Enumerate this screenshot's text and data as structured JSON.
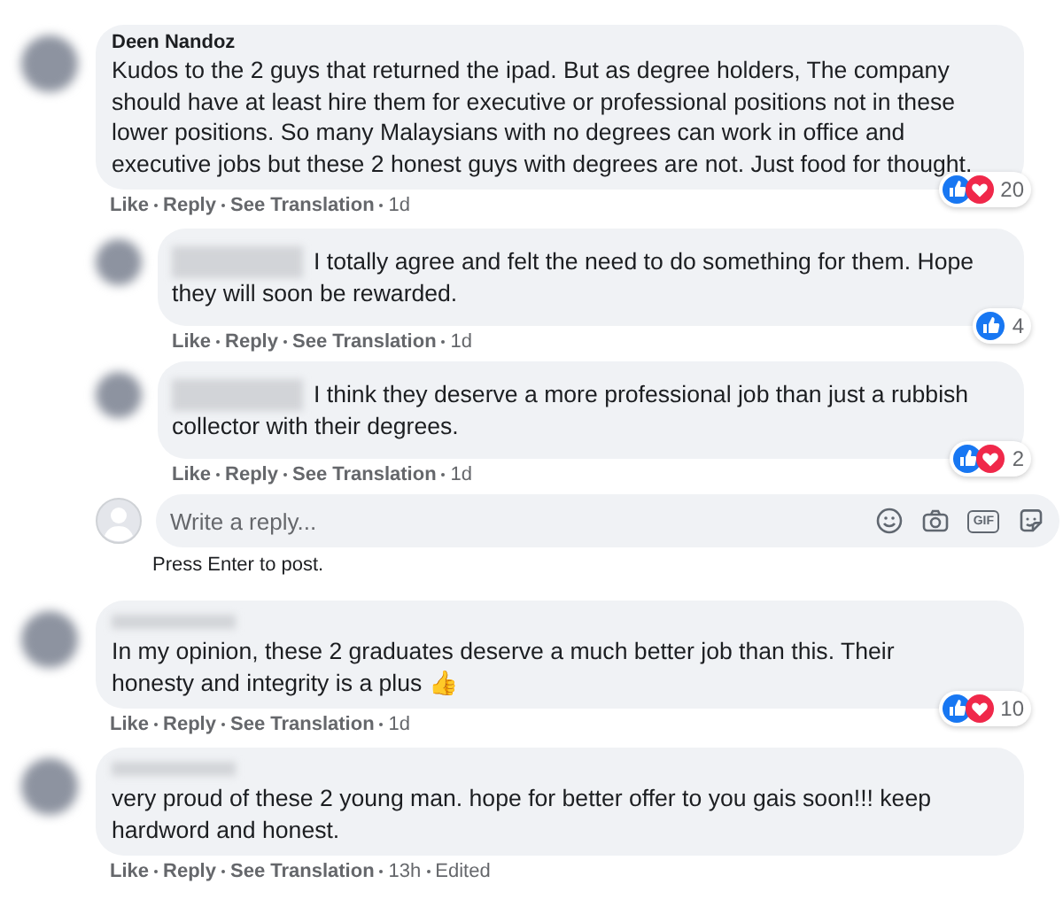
{
  "comments": [
    {
      "author": "Deen Nandoz",
      "text": "Kudos to the 2 guys that returned the ipad. But as degree holders, The company should have at least hire them for executive or professional positions not in these lower positions. So many Malaysians with no degrees can work in office and executive jobs but these 2 honest guys with degrees are not. Just food for thought.",
      "reactions": {
        "like": true,
        "love": true,
        "count": "20"
      },
      "actions": [
        "Like",
        "Reply",
        "See Translation"
      ],
      "time": "1d",
      "replies": [
        {
          "name_blurred": true,
          "text": "I totally agree and felt the need to do something for them. Hope they will soon be rewarded.",
          "reactions": {
            "like": true,
            "love": false,
            "count": "4"
          },
          "actions": [
            "Like",
            "Reply",
            "See Translation"
          ],
          "time": "1d"
        },
        {
          "name_blurred": true,
          "text": "I think they deserve a more professional job than just a rubbish collector with their degrees.",
          "reactions": {
            "like": true,
            "love": true,
            "count": "2"
          },
          "actions": [
            "Like",
            "Reply",
            "See Translation"
          ],
          "time": "1d"
        }
      ],
      "reply_box": {
        "placeholder": "Write a reply...",
        "tools": [
          {
            "kind": "emoji"
          },
          {
            "kind": "camera"
          },
          {
            "kind": "gif",
            "label": "GIF"
          },
          {
            "kind": "sticker"
          }
        ],
        "hint": "Press Enter to post."
      }
    },
    {
      "name_blurred": true,
      "text": "In my opinion, these 2 graduates deserve a much better job than this. Their honesty and integrity is a plus 👍",
      "reactions": {
        "like": true,
        "love": true,
        "count": "10"
      },
      "actions": [
        "Like",
        "Reply",
        "See Translation"
      ],
      "time": "1d"
    },
    {
      "name_blurred": true,
      "text": "very proud of these 2 young man. hope for better offer to you gais soon!!! keep hardword and honest.",
      "actions": [
        "Like",
        "Reply",
        "See Translation"
      ],
      "time": "13h",
      "edited": "Edited"
    }
  ]
}
